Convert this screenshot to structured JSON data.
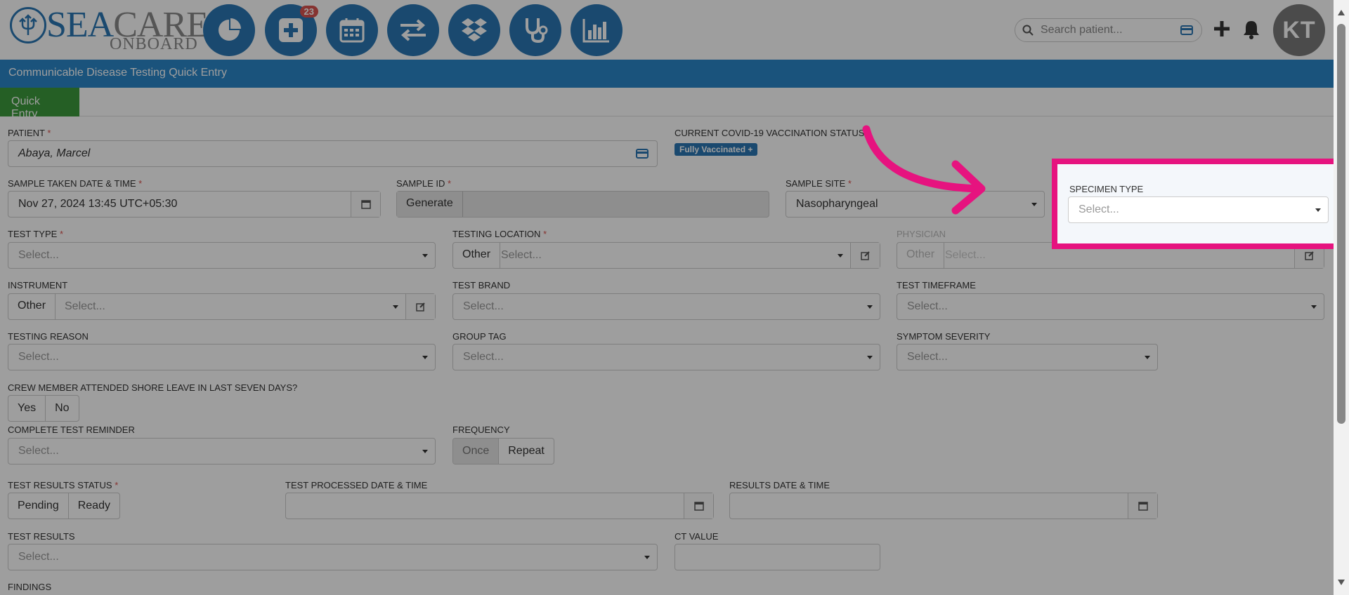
{
  "app": {
    "logo_sea": "SEA",
    "logo_care": "CARE",
    "logo_onboard": "ONBOARD"
  },
  "nav": {
    "items": [
      {
        "icon": "pie-chart-icon"
      },
      {
        "icon": "plus-square-icon",
        "badge": "23"
      },
      {
        "icon": "calendar-icon"
      },
      {
        "icon": "exchange-icon"
      },
      {
        "icon": "dropbox-icon"
      },
      {
        "icon": "stethoscope-icon"
      },
      {
        "icon": "bar-chart-icon"
      }
    ],
    "search_placeholder": "Search patient...",
    "avatar_initials": "KT"
  },
  "page": {
    "title": "Communicable Disease Testing Quick Entry",
    "tab_quick_entry": "Quick Entry"
  },
  "form": {
    "patient_label": "PATIENT",
    "patient_value": "Abaya, Marcel",
    "vacc_label": "CURRENT COVID-19 VACCINATION STATUS",
    "vacc_badge": "Fully Vaccinated +",
    "sample_dt_label": "SAMPLE TAKEN DATE & TIME",
    "sample_dt_value": "Nov 27, 2024 13:45 UTC+05:30",
    "sample_id_label": "SAMPLE ID",
    "generate_label": "Generate",
    "sample_site_label": "SAMPLE SITE",
    "sample_site_value": "Nasopharyngeal",
    "specimen_type_label": "SPECIMEN TYPE",
    "test_type_label": "TEST TYPE",
    "testing_location_label": "TESTING LOCATION",
    "physician_label": "PHYSICIAN",
    "instrument_label": "INSTRUMENT",
    "test_brand_label": "TEST BRAND",
    "test_timeframe_label": "TEST TIMEFRAME",
    "testing_reason_label": "TESTING REASON",
    "group_tag_label": "GROUP TAG",
    "symptom_severity_label": "SYMPTOM SEVERITY",
    "shore_leave_label": "CREW MEMBER ATTENDED SHORE LEAVE IN LAST SEVEN DAYS?",
    "yes_label": "Yes",
    "no_label": "No",
    "reminder_label": "COMPLETE TEST REMINDER",
    "frequency_label": "FREQUENCY",
    "once_label": "Once",
    "repeat_label": "Repeat",
    "results_status_label": "TEST RESULTS STATUS",
    "pending_label": "Pending",
    "ready_label": "Ready",
    "processed_dt_label": "TEST PROCESSED DATE & TIME",
    "results_dt_label": "RESULTS DATE & TIME",
    "test_results_label": "TEST RESULTS",
    "ct_value_label": "CT VALUE",
    "findings_label": "FINDINGS",
    "select_placeholder": "Select...",
    "other_label": "Other"
  },
  "colors": {
    "brand": "#2a77b3",
    "title_bar": "#2a86c9",
    "tab_active": "#3c9a3c",
    "highlight": "#e6137f",
    "required": "#d9534f"
  }
}
